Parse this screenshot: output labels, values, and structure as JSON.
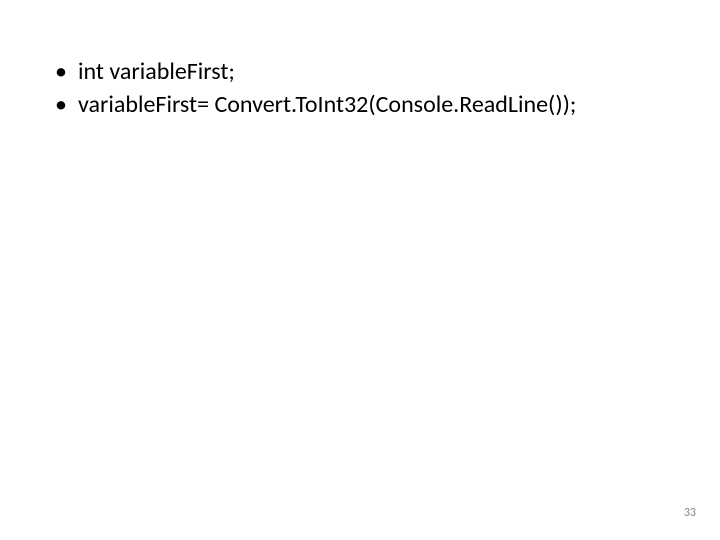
{
  "slide": {
    "bullets": [
      "int variableFirst;",
      "variableFirst= Convert.ToInt32(Console.ReadLine());"
    ],
    "page_number": "33"
  }
}
